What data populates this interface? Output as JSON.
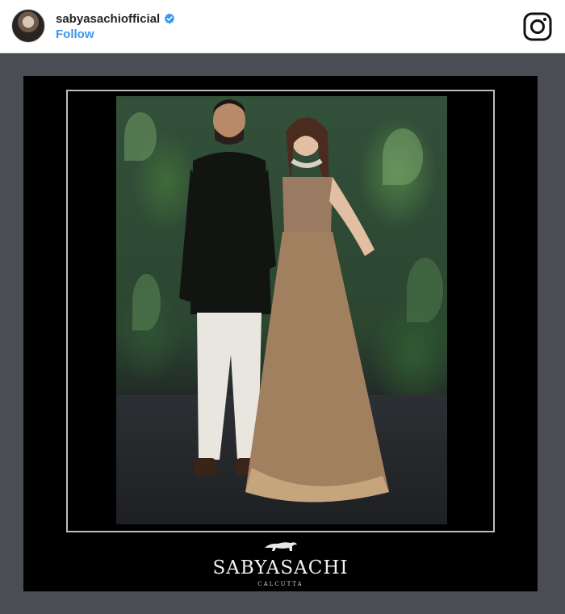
{
  "header": {
    "username": "sabyasachiofficial",
    "follow_label": "Follow",
    "avatar_icon": "profile-avatar",
    "verified_icon": "verified-badge-icon",
    "app_icon": "instagram-icon",
    "colors": {
      "follow": "#3897f0",
      "verified": "#3897f0",
      "text": "#262626"
    }
  },
  "post": {
    "background": "#4a4d54",
    "brand": {
      "logo_icon": "tiger-logo-icon",
      "name": "SABYASACHI",
      "subtitle": "CALCUTTA"
    }
  }
}
